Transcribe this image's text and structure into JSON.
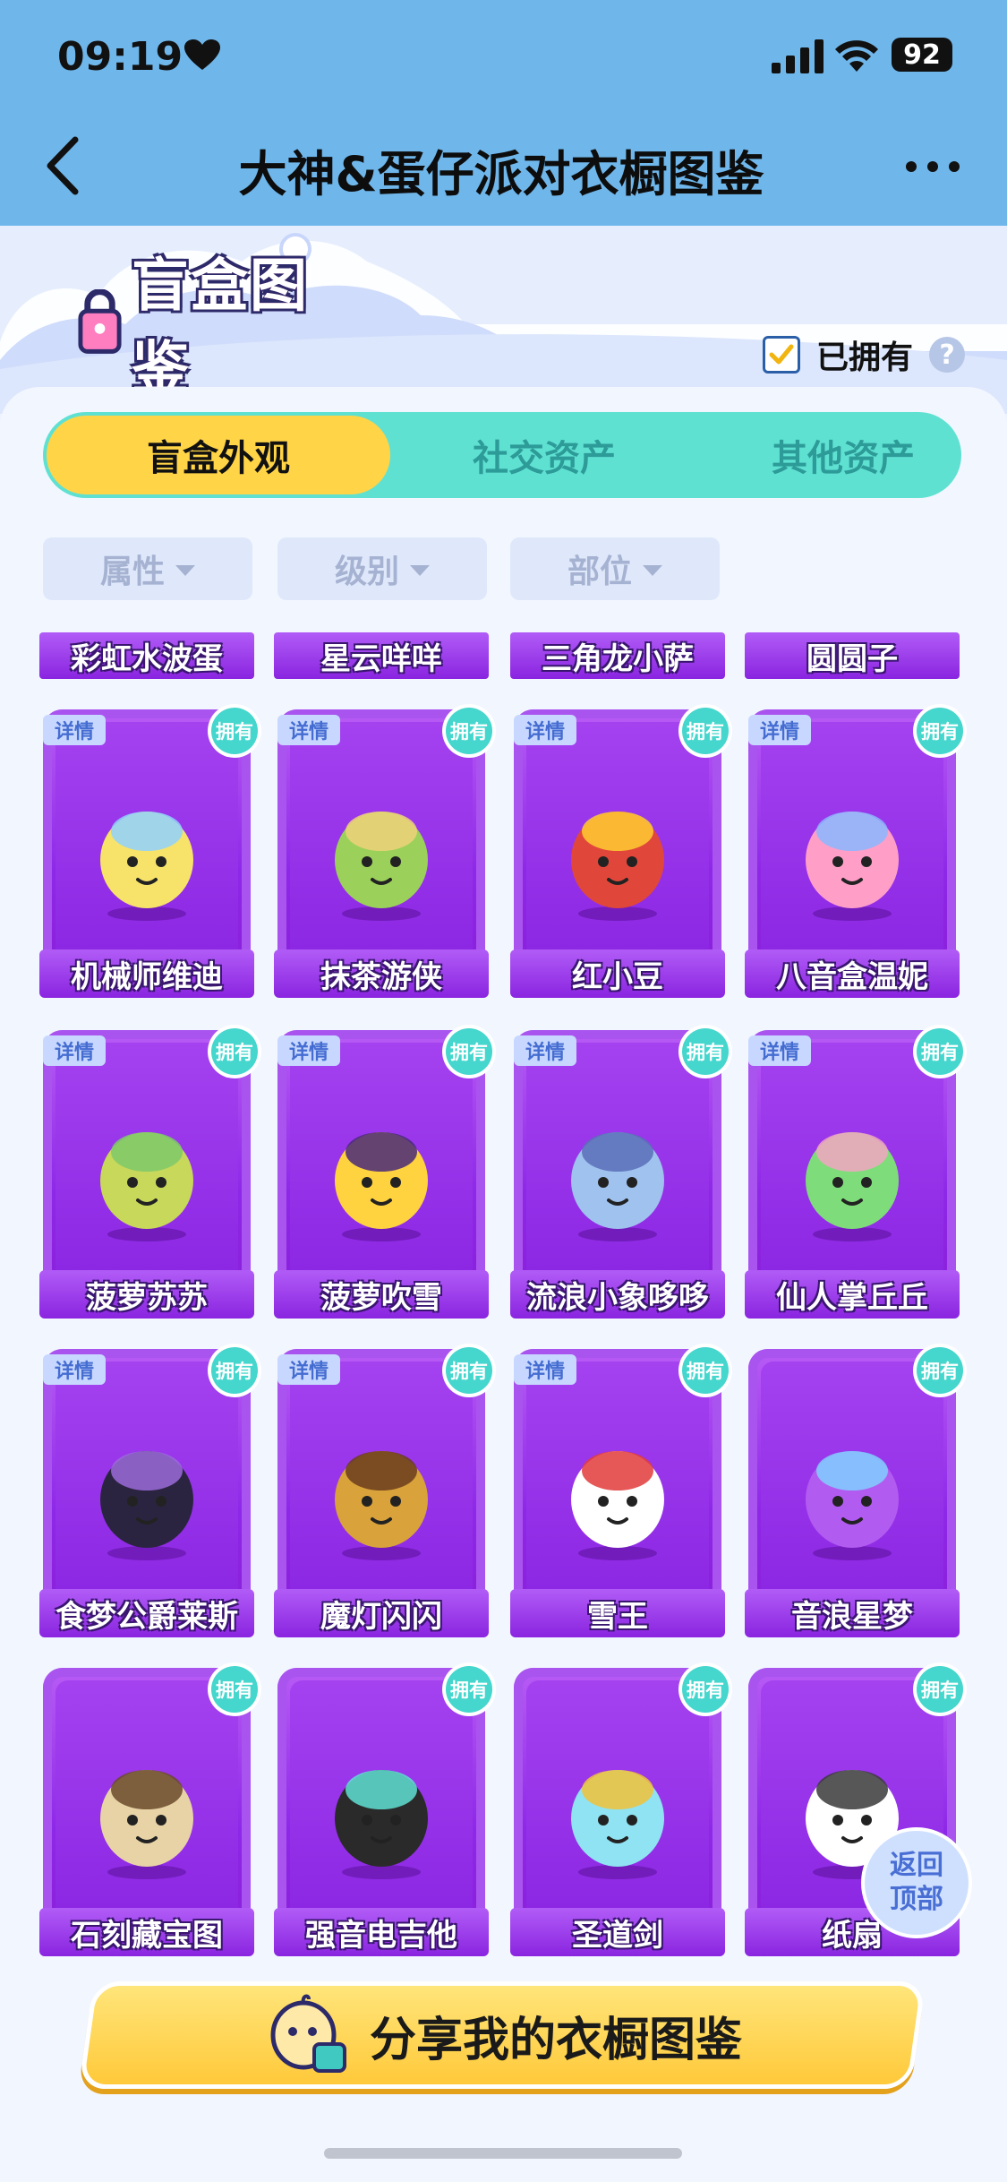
{
  "status_bar": {
    "time": "09:19",
    "battery": "92"
  },
  "header": {
    "title": "大神&蛋仔派对衣橱图鉴"
  },
  "banner": {
    "logo_text": "盲盒图鉴",
    "owned_filter_label": "已拥有",
    "help": "?"
  },
  "tabs": [
    {
      "label": "盲盒外观",
      "active": true
    },
    {
      "label": "社交资产",
      "active": false
    },
    {
      "label": "其他资产",
      "active": false
    }
  ],
  "filters": [
    "属性",
    "级别",
    "部位"
  ],
  "top_strip": [
    "彩虹水波蛋",
    "星云咩咩",
    "三角龙小萨",
    "圆圆子"
  ],
  "card_labels": {
    "detail": "详情",
    "owned": "拥有"
  },
  "cards": [
    {
      "name": "机械师维迪",
      "detail": true,
      "owned": true
    },
    {
      "name": "抹茶游侠",
      "detail": true,
      "owned": true
    },
    {
      "name": "红小豆",
      "detail": true,
      "owned": true
    },
    {
      "name": "八音盒温妮",
      "detail": true,
      "owned": true
    },
    {
      "name": "菠萝苏苏",
      "detail": true,
      "owned": true
    },
    {
      "name": "菠萝吹雪",
      "detail": true,
      "owned": true
    },
    {
      "name": "流浪小象哆哆",
      "detail": true,
      "owned": true
    },
    {
      "name": "仙人掌丘丘",
      "detail": true,
      "owned": true
    },
    {
      "name": "食梦公爵莱斯",
      "detail": true,
      "owned": true
    },
    {
      "name": "魔灯闪闪",
      "detail": true,
      "owned": true
    },
    {
      "name": "雪王",
      "detail": true,
      "owned": true
    },
    {
      "name": "音浪星梦",
      "detail": false,
      "owned": true
    },
    {
      "name": "石刻藏宝图",
      "detail": false,
      "owned": true
    },
    {
      "name": "强音电吉他",
      "detail": false,
      "owned": true
    },
    {
      "name": "圣道剑",
      "detail": false,
      "owned": true
    },
    {
      "name": "纸扇",
      "detail": false,
      "owned": true
    }
  ],
  "back_to_top": {
    "line1": "返回",
    "line2": "顶部"
  },
  "share_button": {
    "label": "分享我的衣橱图鉴"
  },
  "colors": {
    "header_bg": "#6fb6ea",
    "tab_active": "#ffd447",
    "tab_bar": "#5fe1d2",
    "card_purple": "#8e28e8",
    "owned_badge": "#45d6cd"
  }
}
